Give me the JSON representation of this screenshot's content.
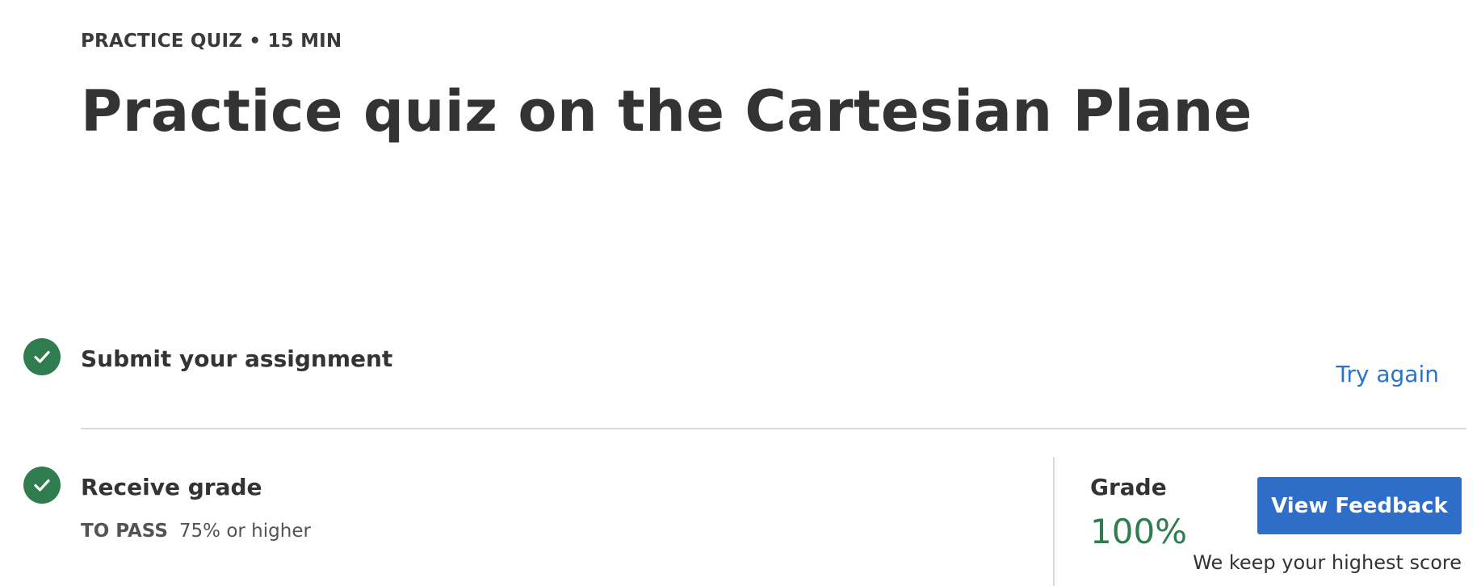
{
  "header": {
    "eyebrow": "PRACTICE QUIZ • 15 MIN",
    "title": "Practice quiz on the Cartesian Plane"
  },
  "steps": {
    "submit": {
      "title": "Submit your assignment",
      "status_icon": "check-icon",
      "action_label": "Try again"
    },
    "receive": {
      "title": "Receive grade",
      "status_icon": "check-icon",
      "to_pass_label": "TO PASS",
      "to_pass_value": "75% or higher"
    }
  },
  "grade": {
    "label": "Grade",
    "value": "100%",
    "button_label": "View Feedback",
    "note": "We keep your highest score"
  },
  "colors": {
    "success": "#2f7d4f",
    "link": "#2a73cc",
    "primary_button": "#2f6ec8"
  }
}
